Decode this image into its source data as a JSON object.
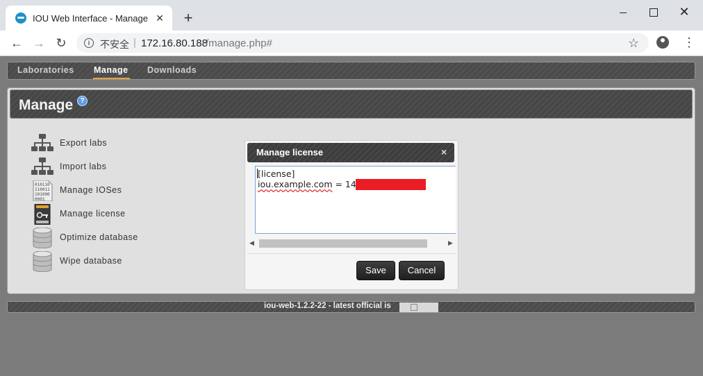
{
  "browser": {
    "tab_title": "IOU Web Interface - Manage",
    "tab_close": "✕",
    "new_tab": "+",
    "security_label": "不安全",
    "url_host": "172.16.80.188",
    "url_path": "/manage.php#",
    "icons": [
      "back-icon",
      "forward-icon",
      "reload-icon",
      "info-icon",
      "star-icon",
      "profile-icon",
      "menu-icon"
    ]
  },
  "nav": {
    "items": [
      {
        "label": "Laboratories"
      },
      {
        "label": "Manage"
      },
      {
        "label": "Downloads"
      }
    ],
    "active": "Manage",
    "accent_color": "#e6a23c"
  },
  "panel": {
    "title": "Manage",
    "help": "?"
  },
  "menu": {
    "items": [
      {
        "label": "Export labs",
        "icon": "sitemap-icon"
      },
      {
        "label": "Import labs",
        "icon": "sitemap-icon"
      },
      {
        "label": "Manage IOSes",
        "icon": "binary-file-icon"
      },
      {
        "label": "Manage license",
        "icon": "license-key-icon"
      },
      {
        "label": "Optimize database",
        "icon": "database-icon"
      },
      {
        "label": "Wipe database",
        "icon": "database-icon"
      }
    ]
  },
  "modal": {
    "title": "Manage license",
    "close": "×",
    "license_line1": "[license]",
    "license_line2_key": "iou.example.com",
    "license_line2_rest": " = 145",
    "redaction_color": "#ea1d24",
    "save_label": "Save",
    "cancel_label": "Cancel"
  },
  "footer": {
    "text": "iou-web-1.2.2-22 - latest official is"
  }
}
